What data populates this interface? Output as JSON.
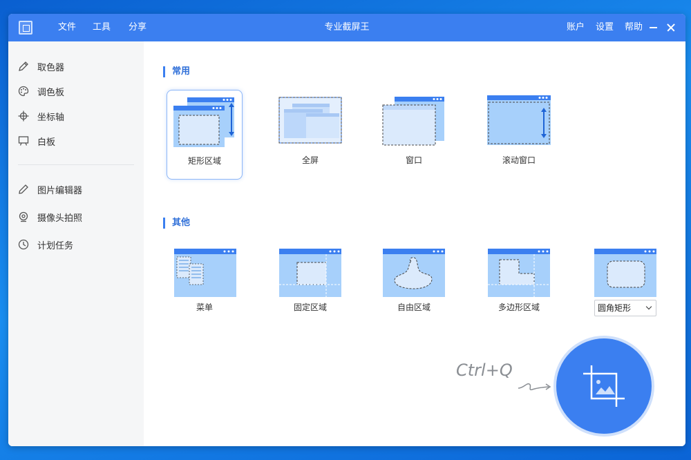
{
  "window": {
    "title": "专业截屏王"
  },
  "menu": {
    "file": "文件",
    "tools": "工具",
    "share": "分享"
  },
  "controls": {
    "account": "账户",
    "settings": "设置",
    "help": "帮助"
  },
  "sidebar": {
    "items": [
      {
        "label": "取色器",
        "icon": "pen-icon"
      },
      {
        "label": "调色板",
        "icon": "palette-icon"
      },
      {
        "label": "坐标轴",
        "icon": "crosshair-icon"
      },
      {
        "label": "白板",
        "icon": "whiteboard-icon"
      },
      {
        "label": "图片编辑器",
        "icon": "pencil-icon"
      },
      {
        "label": "摄像头拍照",
        "icon": "webcam-icon"
      },
      {
        "label": "计划任务",
        "icon": "clock-icon"
      }
    ]
  },
  "sections": {
    "common": "常用",
    "other": "其他"
  },
  "common_modes": [
    {
      "label": "矩形区域",
      "selected": true
    },
    {
      "label": "全屏"
    },
    {
      "label": "窗口"
    },
    {
      "label": "滚动窗口"
    }
  ],
  "other_modes": [
    {
      "label": "菜单"
    },
    {
      "label": "固定区域"
    },
    {
      "label": "自由区域"
    },
    {
      "label": "多边形区域"
    }
  ],
  "shape_select": {
    "value": "圆角矩形"
  },
  "hotkey": {
    "text": "Ctrl+Q"
  },
  "colors": {
    "accent": "#3b7ff0",
    "light": "#a7d0fb",
    "sidebar_bg": "#f5f6f7"
  }
}
